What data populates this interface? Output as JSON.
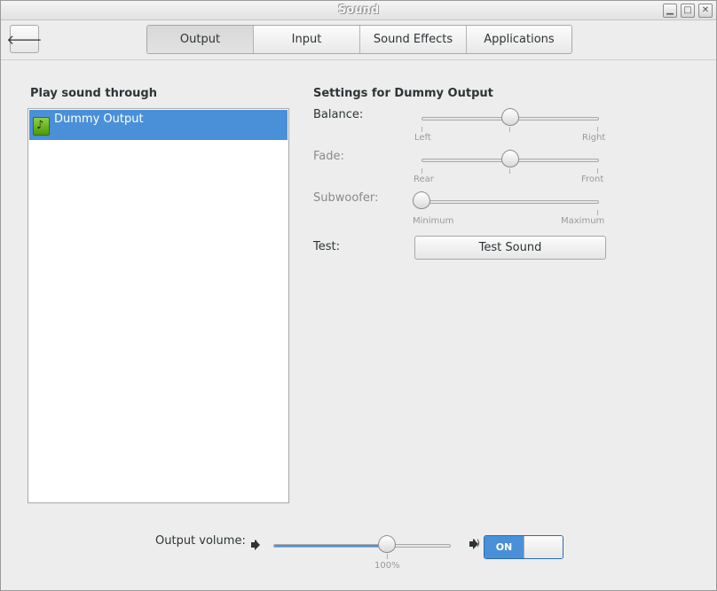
{
  "window": {
    "title": "Sound"
  },
  "toolbar": {
    "back_icon": "back-arrow-icon",
    "tabs": [
      {
        "label": "Output",
        "active": true
      },
      {
        "label": "Input",
        "active": false
      },
      {
        "label": "Sound Effects",
        "active": false
      },
      {
        "label": "Applications",
        "active": false
      }
    ]
  },
  "devices": {
    "heading": "Play sound through",
    "items": [
      {
        "label": "Dummy Output",
        "icon": "audio-card-icon",
        "selected": true
      }
    ]
  },
  "settings": {
    "heading": "Settings for Dummy Output",
    "balance": {
      "label": "Balance:",
      "min_label": "Left",
      "max_label": "Right",
      "value": 0.5
    },
    "fade": {
      "label": "Fade:",
      "min_label": "Rear",
      "max_label": "Front",
      "value": 0.5
    },
    "subwoofer": {
      "label": "Subwoofer:",
      "min_label": "Minimum",
      "max_label": "Maximum",
      "value": 0.0
    },
    "test": {
      "label": "Test:",
      "button_label": "Test Sound"
    }
  },
  "volume": {
    "label": "Output volume:",
    "value_percent": 64,
    "mark_label": "100%",
    "mark_percent": 64,
    "switch_label": "ON",
    "switch_on": true
  },
  "colors": {
    "accent": "#4a90d9",
    "background": "#ededed"
  }
}
